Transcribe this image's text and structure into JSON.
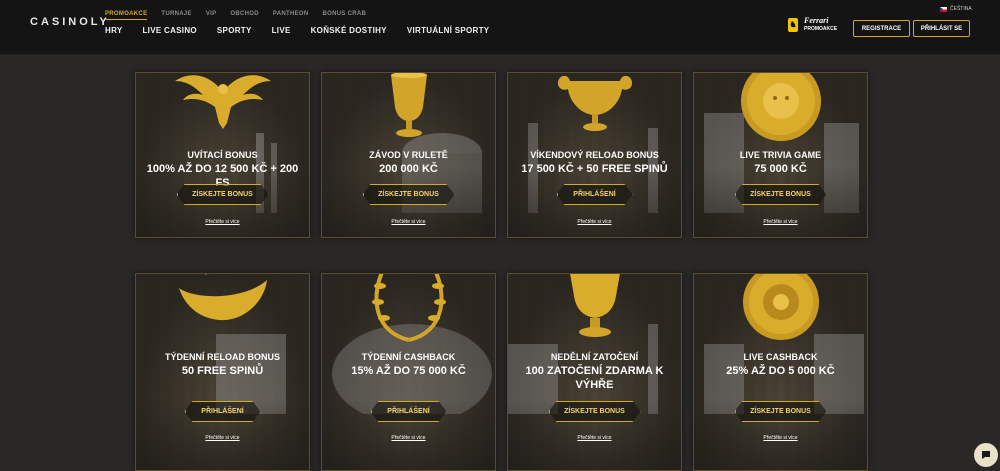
{
  "header": {
    "logo": "CASINOLY",
    "topnav": [
      "PROMOAKCE",
      "TURNAJE",
      "VIP",
      "OBCHOD",
      "PANTHEON",
      "BONUS CRAB"
    ],
    "mainnav": [
      "HRY",
      "LIVE CASINO",
      "SPORTY",
      "LIVE",
      "KOŇSKÉ DOSTIHY",
      "VIRTUÁLNÍ SPORTY"
    ],
    "ferrari_brand": "Ferrari",
    "ferrari_sub": "PROMOAKCE",
    "language": "ČEŠTINA",
    "register_label": "REGISTRACE",
    "login_label": "PŘIHLÁSIT SE"
  },
  "promos": [
    {
      "title": "UVÍTACÍ BONUS",
      "amount": "100% AŽ DO 12 500 KČ + 200 FS",
      "button": "ZÍSKEJTE BONUS",
      "link": "Přečtěte si více",
      "icon": "eagle-icon"
    },
    {
      "title": "ZÁVOD V RULETĚ",
      "amount": "200 000 KČ",
      "button": "ZÍSKEJTE BONUS",
      "link": "Přečtěte si více",
      "icon": "goblet-icon"
    },
    {
      "title": "VÍKENDOVÝ RELOAD BONUS",
      "amount": "17 500 KČ + 50 FREE SPINŮ",
      "button": "PŘIHLÁŠENÍ",
      "link": "Přečtěte si více",
      "icon": "chalice-icon"
    },
    {
      "title": "LIVE TRIVIA GAME",
      "amount": "75 000 KČ",
      "button": "ZÍSKEJTE BONUS",
      "link": "Přečtěte si více",
      "icon": "medusa-shield-icon"
    },
    {
      "title": "TÝDENNÍ RELOAD BONUS",
      "amount": "50 FREE SPINŮ",
      "button": "PŘIHLÁŠENÍ",
      "link": "Přečtěte si více",
      "icon": "pectoral-icon"
    },
    {
      "title": "TÝDENNÍ CASHBACK",
      "amount": "15% AŽ DO 75 000 KČ",
      "button": "PŘIHLÁŠENÍ",
      "link": "Přečtěte si více",
      "icon": "laurel-wreath-icon"
    },
    {
      "title": "NEDĚLNÍ ZATOČENÍ",
      "amount": "100 ZATOČENÍ ZDARMA K VÝHŘE",
      "button": "ZÍSKEJTE BONUS",
      "link": "Přečtěte si více",
      "icon": "vase-icon"
    },
    {
      "title": "LIVE CASHBACK",
      "amount": "25% AŽ DO 5 000 KČ",
      "button": "ZÍSKEJTE BONUS",
      "link": "Přečtěte si více",
      "icon": "gold-disc-icon"
    }
  ],
  "colors": {
    "accent": "#d4a82a",
    "background": "#2a2826",
    "header": "#141414"
  }
}
